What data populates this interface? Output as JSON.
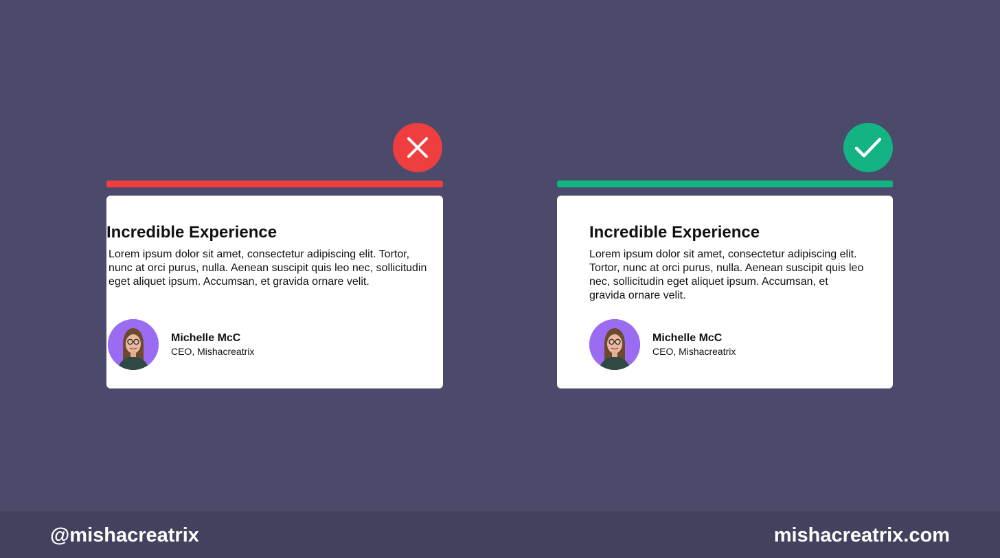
{
  "colors": {
    "background": "#4b4a6a",
    "footer": "#43425e",
    "bad": "#ef3e40",
    "good": "#13b383",
    "avatar_bg": "#9b6cf2",
    "card": "#ffffff"
  },
  "bad_example": {
    "icon": "x-mark-icon",
    "card": {
      "title": "Incredible Experience",
      "body": "Lorem ipsum dolor sit amet, consectetur adipiscing elit. Tortor, nunc at orci purus, nulla. Aenean suscipit quis leo nec, sollicitudin eget aliquet ipsum. Accumsan, et gravida ornare velit.",
      "author_name": "Michelle McC",
      "author_role": "CEO, Mishacreatrix"
    }
  },
  "good_example": {
    "icon": "checkmark-icon",
    "card": {
      "title": "Incredible Experience",
      "body": "Lorem ipsum dolor sit amet, consectetur adipiscing elit. Tortor, nunc at orci purus, nulla. Aenean suscipit quis leo nec, sollicitudin eget aliquet ipsum. Accumsan, et gravida ornare velit.",
      "author_name": "Michelle McC",
      "author_role": "CEO, Mishacreatrix"
    }
  },
  "footer": {
    "handle": "@mishacreatrix",
    "website": "mishacreatrix.com"
  }
}
